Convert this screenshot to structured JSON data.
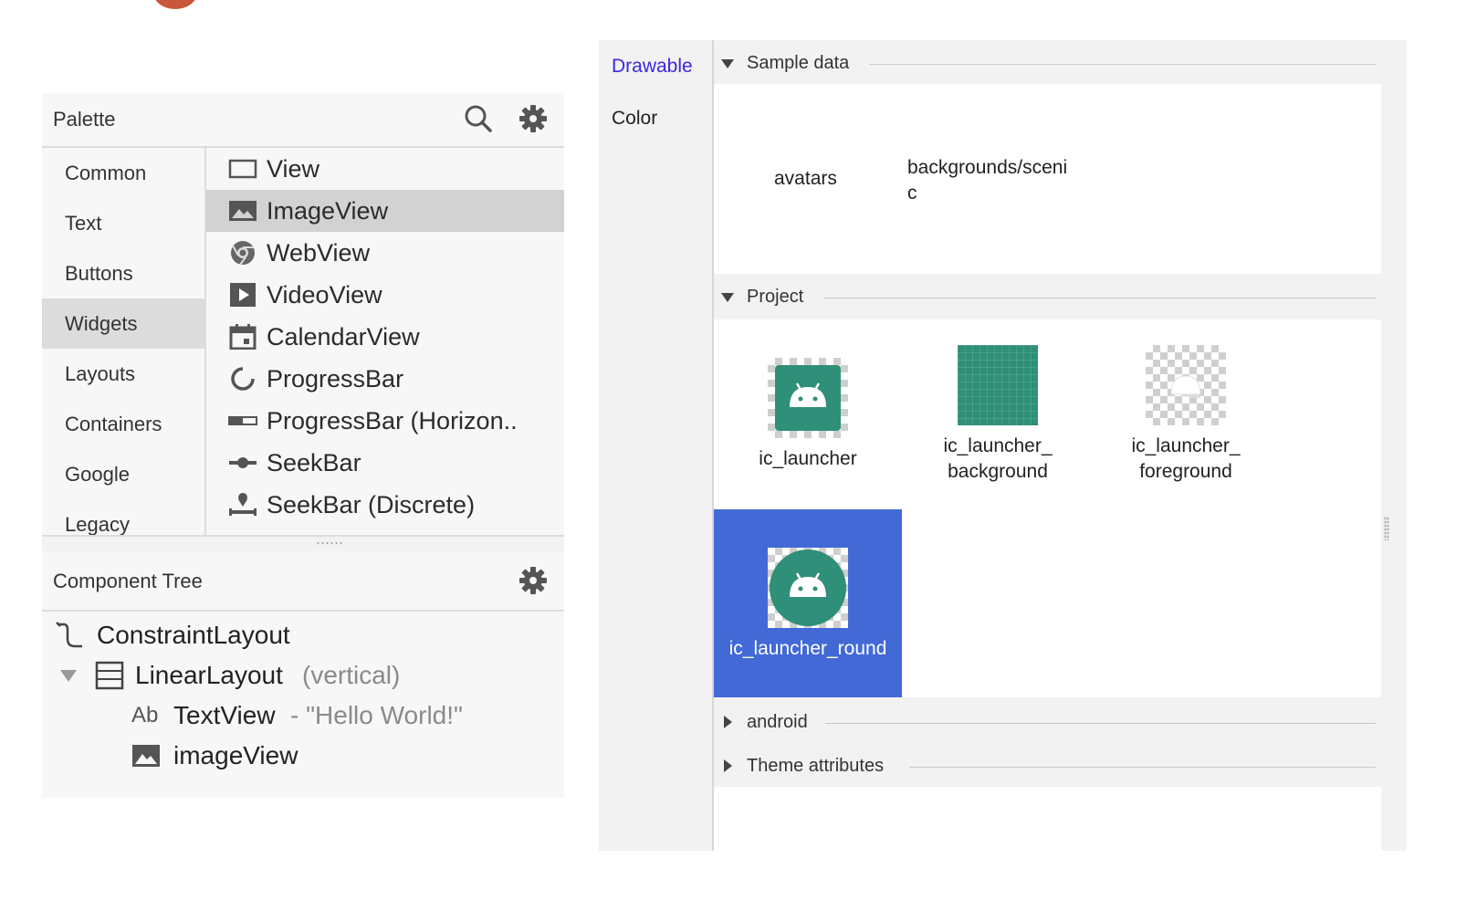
{
  "palette": {
    "title": "Palette",
    "categories": [
      "Common",
      "Text",
      "Buttons",
      "Widgets",
      "Layouts",
      "Containers",
      "Google",
      "Legacy"
    ],
    "selected_category": "Widgets",
    "widgets": [
      {
        "label": "View",
        "icon": "view-icon"
      },
      {
        "label": "ImageView",
        "icon": "image-icon"
      },
      {
        "label": "WebView",
        "icon": "webview-icon"
      },
      {
        "label": "VideoView",
        "icon": "video-icon"
      },
      {
        "label": "CalendarView",
        "icon": "calendar-icon"
      },
      {
        "label": "ProgressBar",
        "icon": "progress-circle-icon"
      },
      {
        "label": "ProgressBar (Horizon..",
        "icon": "progress-horizontal-icon"
      },
      {
        "label": "SeekBar",
        "icon": "seekbar-icon"
      },
      {
        "label": "SeekBar (Discrete)",
        "icon": "seekbar-discrete-icon"
      }
    ],
    "selected_widget": "ImageView"
  },
  "component_tree": {
    "title": "Component Tree",
    "nodes": {
      "root": "ConstraintLayout",
      "linear": "LinearLayout",
      "linear_hint": "(vertical)",
      "textview": "TextView",
      "textview_hint": "- \"Hello World!\"",
      "textview_prefix": "Ab",
      "imageview": "imageView"
    }
  },
  "resources": {
    "tabs": [
      "Drawable",
      "Color"
    ],
    "active_tab": "Drawable",
    "accent_color": "#3d27e6",
    "selection_color": "#4269d6",
    "icon_green": "#2f8f78",
    "sections": {
      "sample": {
        "title": "Sample data",
        "expanded": true,
        "items": [
          "avatars",
          "backgrounds/sceni",
          "c"
        ]
      },
      "project": {
        "title": "Project",
        "expanded": true,
        "items": [
          {
            "label_line1": "ic_launcher",
            "label_line2": ""
          },
          {
            "label_line1": "ic_launcher_",
            "label_line2": "background"
          },
          {
            "label_line1": "ic_launcher_",
            "label_line2": "foreground"
          },
          {
            "label_line1": "ic_launcher_round",
            "label_line2": ""
          }
        ],
        "selected": "ic_launcher_round"
      },
      "android": {
        "title": "android",
        "expanded": false
      },
      "theme": {
        "title": "Theme attributes",
        "expanded": false
      }
    }
  }
}
